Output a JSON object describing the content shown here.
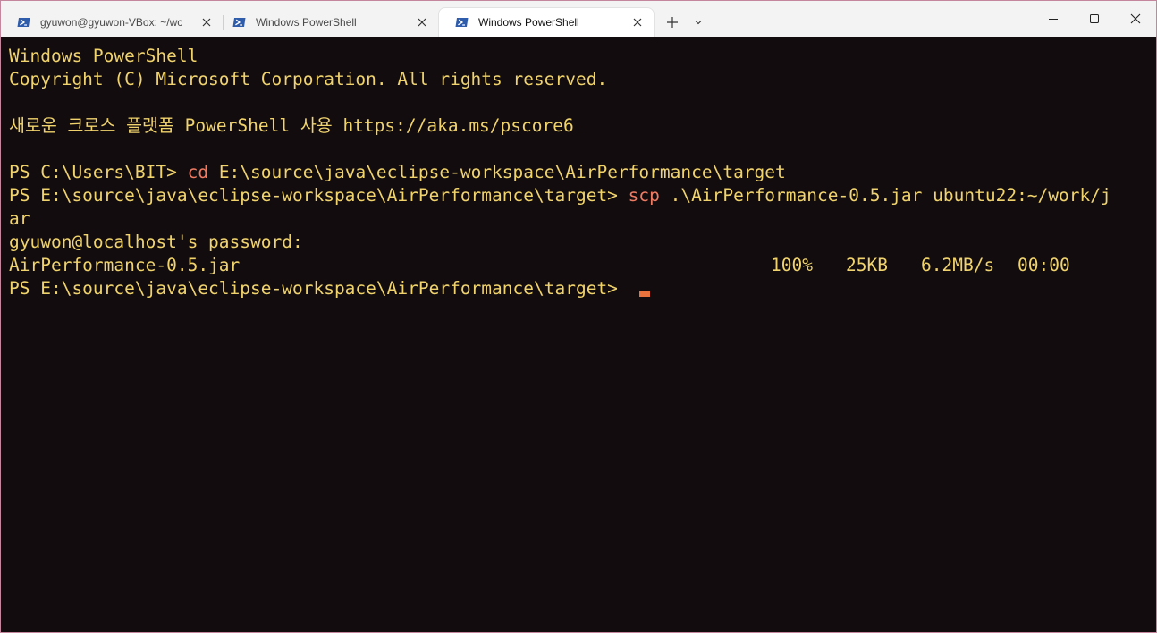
{
  "tabs": [
    {
      "title": "gyuwon@gyuwon-VBox: ~/wc",
      "active": false
    },
    {
      "title": "Windows PowerShell",
      "active": false
    },
    {
      "title": "Windows PowerShell",
      "active": true
    }
  ],
  "icons": {
    "tab_icon": "powershell-icon",
    "new_tab": "plus-icon",
    "dropdown": "chevron-down-icon",
    "minimize": "minimize-icon",
    "maximize": "maximize-icon",
    "close": "close-icon"
  },
  "colors": {
    "background": "#120c0e",
    "text": "#f0d36d",
    "command": "#f07a62",
    "cursor": "#e8733c",
    "tabbar": "#f3f3f3"
  },
  "terminal": {
    "header_1": "Windows PowerShell",
    "header_2": "Copyright (C) Microsoft Corporation. All rights reserved.",
    "notice": "새로운 크로스 플랫폼 PowerShell 사용 https://aka.ms/pscore6",
    "prompt_1": "PS C:\\Users\\BIT> ",
    "command_1": "cd",
    "args_1": " E:\\source\\java\\eclipse-workspace\\AirPerformance\\target",
    "prompt_2": "PS E:\\source\\java\\eclipse-workspace\\AirPerformance\\target> ",
    "command_2": "scp",
    "args_2": " .\\AirPerformance-0.5.jar ubuntu22:~/work/j",
    "args_2_wrap": "ar",
    "password_prompt": "gyuwon@localhost's password:",
    "transfer": {
      "file": "AirPerformance-0.5.jar",
      "percent": "100%",
      "size": "25KB",
      "rate": "6.2MB/s",
      "time": "00:00"
    },
    "prompt_3": "PS E:\\source\\java\\eclipse-workspace\\AirPerformance\\target> "
  }
}
